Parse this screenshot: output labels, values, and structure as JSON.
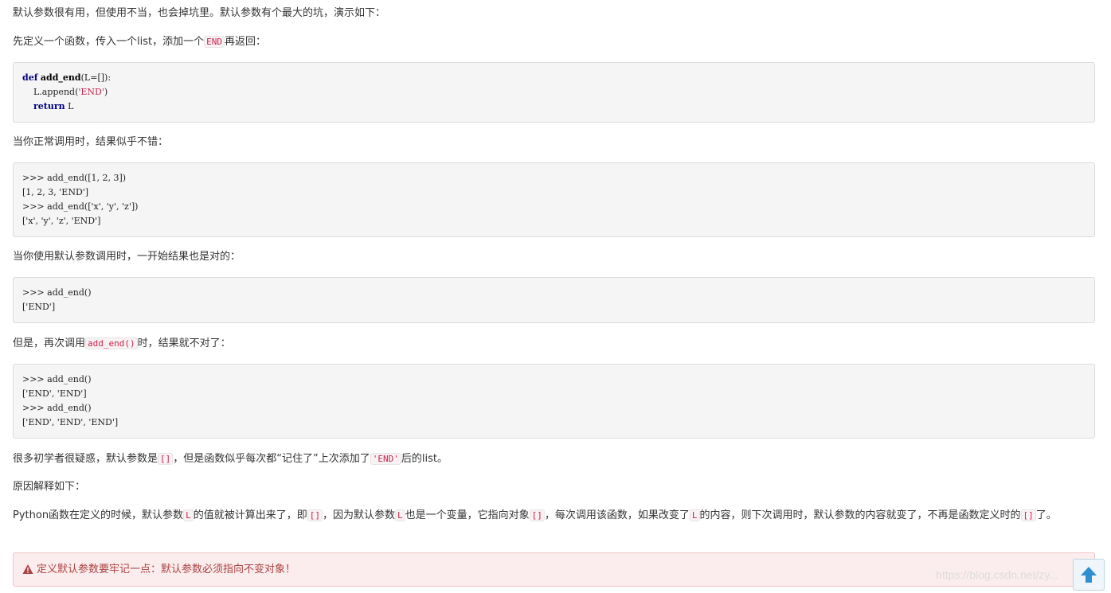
{
  "paragraphs": {
    "p1": "默认参数很有用，但使用不当，也会掉坑里。默认参数有个最大的坑，演示如下：",
    "p2_before": "先定义一个函数，传入一个list，添加一个",
    "p2_code": "END",
    "p2_after": "再返回：",
    "p3": "当你正常调用时，结果似乎不错：",
    "p4": "当你使用默认参数调用时，一开始结果也是对的：",
    "p5_before": "但是，再次调用",
    "p5_code": "add_end()",
    "p5_after": "时，结果就不对了：",
    "p6_before": "很多初学者很疑惑，默认参数是",
    "p6_code1": "[]",
    "p6_mid": "，但是函数似乎每次都“记住了”上次添加了",
    "p6_code2": "'END'",
    "p6_after": "后的list。",
    "p7": "原因解释如下：",
    "p8_a": "Python函数在定义的时候，默认参数",
    "p8_c1": "L",
    "p8_b": "的值就被计算出来了，即",
    "p8_c2": "[]",
    "p8_c": "，因为默认参数",
    "p8_c3": "L",
    "p8_d": "也是一个变量，它指向对象",
    "p8_c4": "[]",
    "p8_e": "，每次调用该函数，如果改变了",
    "p8_c5": "L",
    "p8_f": "的内容，则下次调用时，默认参数的内容就变了，不再是函数定义时的",
    "p8_c6": "[]",
    "p8_g": "了。"
  },
  "code_blocks": {
    "def": {
      "l1_kw": "def",
      "l1_fn": "add_end",
      "l1_rest": "(L=[]):",
      "l2_pre": "    L.append(",
      "l2_str": "'END'",
      "l2_post": ")",
      "l3_kw": "return",
      "l3_rest": " L"
    },
    "normal_call": [
      ">>> add_end([1, 2, 3])",
      "[1, 2, 3, 'END']",
      ">>> add_end(['x', 'y', 'z'])",
      "['x', 'y', 'z', 'END']"
    ],
    "default_call": [
      ">>> add_end()",
      "['END']"
    ],
    "repeat_call": [
      ">>> add_end()",
      "['END', 'END']",
      ">>> add_end()",
      "['END', 'END', 'END']"
    ]
  },
  "alert": {
    "icon": "warning-icon",
    "text": "定义默认参数要牢记一点：默认参数必须指向不变对象！"
  },
  "watermark": "https://blog.csdn.net/zy...",
  "back_to_top": {
    "icon": "arrow-up-icon"
  },
  "colors": {
    "inline_code": "#c7254e",
    "alert_text": "#a94442",
    "alert_bg": "#fbeced",
    "code_bg": "#f5f5f5"
  }
}
